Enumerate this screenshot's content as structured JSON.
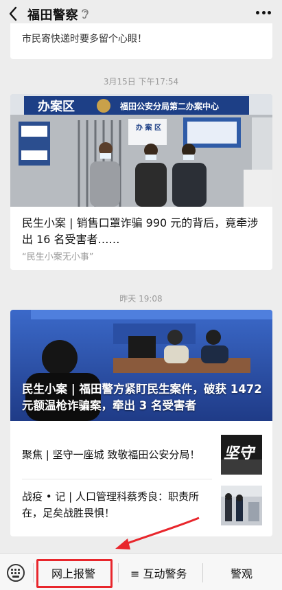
{
  "header": {
    "title": "福田警察"
  },
  "feed": {
    "prev_snippet": "市民寄快递时要多留个心眼！",
    "post1": {
      "timestamp": "3月15日 下午17:54",
      "headline": "民生小案 | 销售口罩诈骗 990 元的背后，竟牵涉出 16 名受害者……",
      "source": "“民生小案无小事”",
      "photo_signs": {
        "area": "办案区",
        "center": "福田公安分局第二办案中心",
        "board": "办 案 区"
      }
    },
    "post2": {
      "timestamp": "昨天 19:08",
      "headline": "民生小案 | 福田警方紧盯民生案件，破获 1472 元额温枪诈骗案，牵出 3 名受害者",
      "items": [
        {
          "title": "聚焦 | 坚守一座城 致敬福田公安分局！",
          "thumb_text": "坚守"
        },
        {
          "title": "战疫 • 记 | 人口管理科蔡秀良：职责所在，足矣战胜畏惧！"
        }
      ]
    }
  },
  "bottom_menu": {
    "items": [
      "网上报警",
      "≡ 互动警务",
      "警观"
    ]
  },
  "colors": {
    "highlight": "#e8262c",
    "page_bg": "#ededed"
  }
}
